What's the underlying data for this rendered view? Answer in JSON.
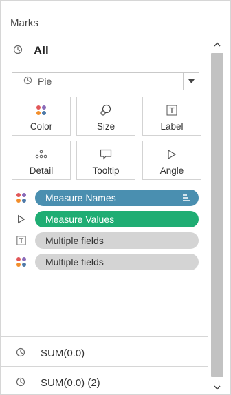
{
  "panel": {
    "title": "Marks"
  },
  "card": {
    "header_icon": "pie-clock-icon",
    "header_label": "All",
    "mark_type": {
      "icon": "pie-clock-icon",
      "value": "Pie"
    },
    "buttons": [
      {
        "id": "color",
        "label": "Color",
        "icon": "color-dots-icon"
      },
      {
        "id": "size",
        "label": "Size",
        "icon": "size-icon"
      },
      {
        "id": "label",
        "label": "Label",
        "icon": "label-T-icon"
      },
      {
        "id": "detail",
        "label": "Detail",
        "icon": "detail-dots-icon"
      },
      {
        "id": "tooltip",
        "label": "Tooltip",
        "icon": "tooltip-icon"
      },
      {
        "id": "angle",
        "label": "Angle",
        "icon": "angle-icon"
      }
    ],
    "fields": [
      {
        "icon": "color-dots-icon",
        "label": "Measure Names",
        "style": "blue",
        "sort_icon": true
      },
      {
        "icon": "angle-icon",
        "label": "Measure Values",
        "style": "green"
      },
      {
        "icon": "label-T-icon",
        "label": "Multiple fields",
        "style": "gray"
      },
      {
        "icon": "color-dots-icon",
        "label": "Multiple fields",
        "style": "gray"
      }
    ]
  },
  "sub_cards": [
    {
      "icon": "pie-clock-icon",
      "label": "SUM(0.0)"
    },
    {
      "icon": "pie-clock-icon",
      "label": "SUM(0.0) (2)"
    }
  ],
  "colors": {
    "blue_pill": "#4a8fb0",
    "green_pill": "#1fad73",
    "gray_pill": "#d4d4d4",
    "dot_colors": [
      "#e15759",
      "#8a6bb8",
      "#f28e2b",
      "#4e79a7"
    ]
  }
}
